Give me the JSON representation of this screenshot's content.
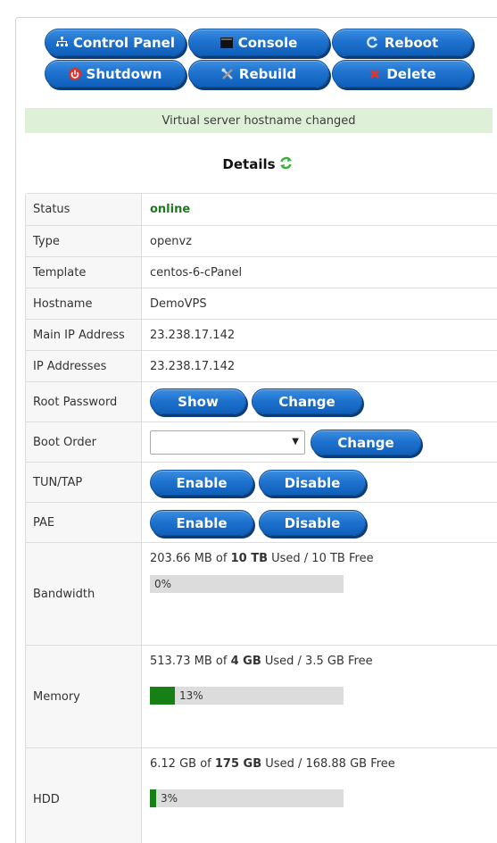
{
  "actions": {
    "control_panel": "Control Panel",
    "console": "Console",
    "reboot": "Reboot",
    "shutdown": "Shutdown",
    "rebuild": "Rebuild",
    "delete": "Delete"
  },
  "flash_message": "Virtual server hostname changed",
  "details_title": "Details",
  "details": {
    "status": {
      "label": "Status",
      "value": "online"
    },
    "type": {
      "label": "Type",
      "value": "openvz"
    },
    "template": {
      "label": "Template",
      "value": "centos-6-cPanel"
    },
    "hostname": {
      "label": "Hostname",
      "value": "DemoVPS"
    },
    "main_ip": {
      "label": "Main IP Address",
      "value": "23.238.17.142"
    },
    "ip_addresses": {
      "label": "IP Addresses",
      "value": "23.238.17.142"
    },
    "root_password": {
      "label": "Root Password",
      "show": "Show",
      "change": "Change"
    },
    "boot_order": {
      "label": "Boot Order",
      "selected": "",
      "change": "Change"
    },
    "tun_tap": {
      "label": "TUN/TAP",
      "enable": "Enable",
      "disable": "Disable"
    },
    "pae": {
      "label": "PAE",
      "enable": "Enable",
      "disable": "Disable"
    },
    "bandwidth": {
      "label": "Bandwidth",
      "used": "203.66 MB",
      "of": "of",
      "total": "10 TB",
      "rest": "Used / 10 TB Free",
      "percent_label": "0%",
      "percent": 0
    },
    "memory": {
      "label": "Memory",
      "used": "513.73 MB",
      "of": "of",
      "total": "4 GB",
      "rest": "Used / 3.5 GB Free",
      "percent_label": "13%",
      "percent": 13
    },
    "hdd": {
      "label": "HDD",
      "used": "6.12 GB",
      "of": "of",
      "total": "175 GB",
      "rest": "Used / 168.88 GB Free",
      "percent_label": "3%",
      "percent": 3
    }
  },
  "colors": {
    "button_blue": "#1f73cf",
    "online_green": "#1f7a1f",
    "bar_fill": "#168016",
    "flash_bg": "#dff0d8"
  }
}
